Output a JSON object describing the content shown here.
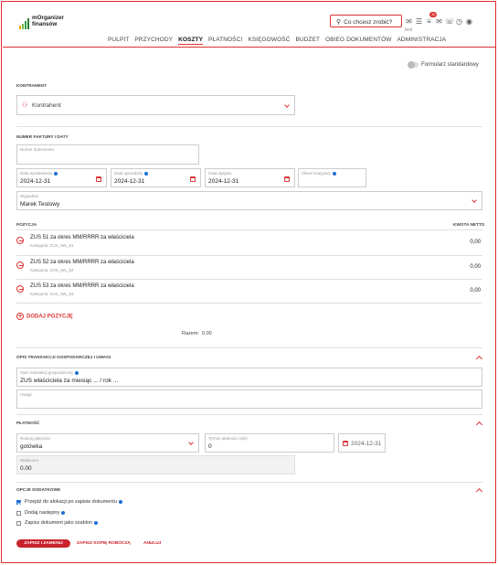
{
  "app": {
    "logo_line1": "mOrganizer",
    "logo_line2": "finansów",
    "logo_colors": [
      "#f2a900",
      "#7ab648",
      "#2f9b48",
      "#2e7d32"
    ]
  },
  "header": {
    "search_label": "Co chcesz zrobić?",
    "user": "test",
    "badge": "10",
    "icons": [
      "chat-icon",
      "list-icon",
      "menu-icon",
      "mail-icon",
      "phone-icon",
      "clock-icon",
      "user-icon"
    ]
  },
  "nav": [
    "PULPIT",
    "PRZYCHODY",
    "KOSZTY",
    "PŁATNOŚCI",
    "KSIĘGOWOŚĆ",
    "BUDŻET",
    "OBIEG DOKUMENTÓW",
    "ADMINISTRACJA"
  ],
  "nav_active": "KOSZTY",
  "form_toggle": "Formularz standardowy",
  "kontrahent": {
    "section": "KONTRAHENT",
    "placeholder": "Kontrahent"
  },
  "invoice": {
    "section": "NUMER FAKTURY I DATY",
    "number_label": "Numer dokumentu",
    "date_issue_label": "Data wystawienia",
    "date_issue": "2024-12-31",
    "date_sale_label": "Data sprzedaży",
    "date_sale": "2024-12-31",
    "date_receipt_label": "Data wpływu",
    "date_receipt": "2024-12-31",
    "booking_label": "Okres księgowy",
    "seller_label": "Wygodnie",
    "seller_value": "Marek Testowy"
  },
  "positions": {
    "section": "POZYCJA",
    "amount_header": "KWOTA NETTO",
    "items": [
      {
        "title": "ZUS 51 za okres MM/RRRR za właściciela",
        "category": "Kategoria: ZUS_WŁ_51",
        "amount": "0,00"
      },
      {
        "title": "ZUS 52 za okres MM/RRRR za właściciela",
        "category": "Kategoria: ZUS_WŁ_52",
        "amount": "0,00"
      },
      {
        "title": "ZUS 53 za okres MM/RRRR za właściciela",
        "category": "Kategoria: ZUS_WŁ_53",
        "amount": "0,00"
      }
    ],
    "add_label": "DODAJ POZYCJĘ",
    "total_label": "Razem:",
    "total_value": "0,00"
  },
  "description": {
    "section": "OPIS TRANSAKCJI GOSPODARCZEJ I UWAGI",
    "desc_label": "Opis transakcji gospodarczej",
    "desc_value": "ZUS właściciela za miesiąc ... / rok ...",
    "notes_label": "Uwagi"
  },
  "payment": {
    "section": "PŁATNOŚĆ",
    "method_label": "Rodzaj płatności",
    "method_value": "gotówka",
    "term_label": "Termin płatności (dni)",
    "term_value": "0",
    "due_date": "2024-12-31",
    "paid_label": "Wpłacono",
    "paid_value": "0.00"
  },
  "options": {
    "section": "OPCJE DODATKOWE",
    "items": [
      {
        "label": "Przejdź do alokacji po zapisie dokumentu",
        "checked": true
      },
      {
        "label": "Dodaj następny",
        "checked": false
      },
      {
        "label": "Zapisz dokument jako szablon",
        "checked": false
      }
    ]
  },
  "actions": {
    "save_close": "ZAPISZ I ZAMKNIJ",
    "save_draft": "ZAPISZ KOPIĘ ROBOCZĄ",
    "cancel": "ANULUJ"
  },
  "accent": "#d33333"
}
